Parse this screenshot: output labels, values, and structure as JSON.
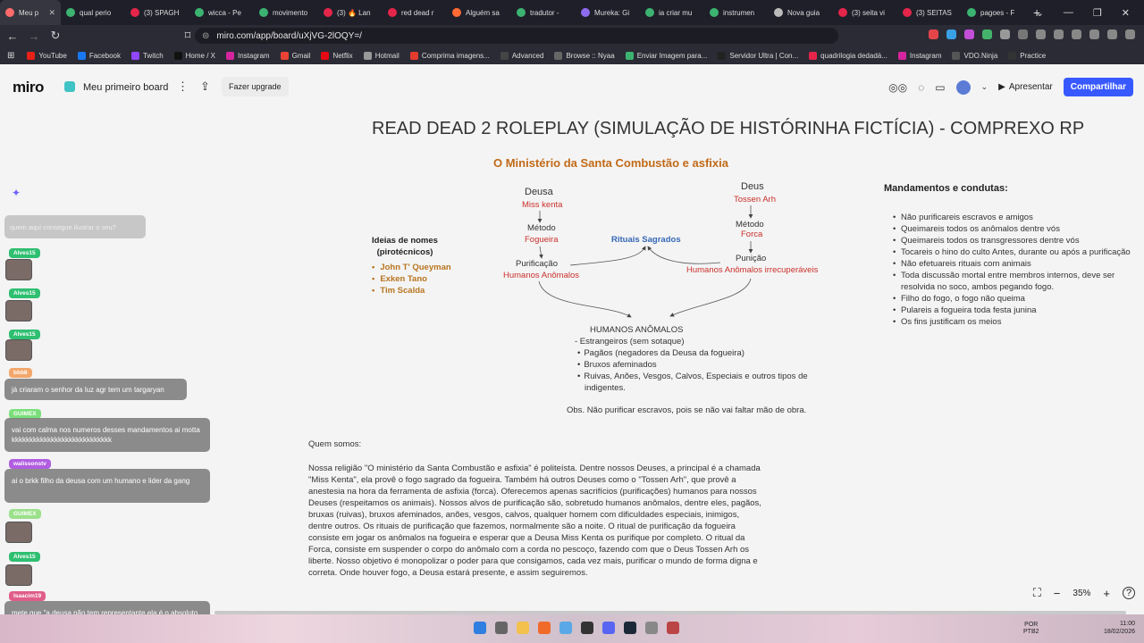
{
  "browser": {
    "tabs": [
      {
        "title": "Meu p",
        "color": "#ff6b6b",
        "active": true
      },
      {
        "title": "qual perio",
        "color": "#3cb371"
      },
      {
        "title": "(3) SPAGH",
        "color": "#e5254a"
      },
      {
        "title": "wicca - Pe",
        "color": "#3cb371"
      },
      {
        "title": "movimento",
        "color": "#3cb371"
      },
      {
        "title": "(3) 🔥 Lan",
        "color": "#e5254a"
      },
      {
        "title": "red dead r",
        "color": "#e5254a"
      },
      {
        "title": "Alguém sa",
        "color": "#ff6b35"
      },
      {
        "title": "tradutor -",
        "color": "#3cb371"
      },
      {
        "title": "Mureka: Gi",
        "color": "#8e6cf0"
      },
      {
        "title": "ia criar mu",
        "color": "#3cb371"
      },
      {
        "title": "instrumen",
        "color": "#3cb371"
      },
      {
        "title": "Nova guia",
        "color": "#bbbbbb"
      },
      {
        "title": "(3) seita vi",
        "color": "#e5254a"
      },
      {
        "title": "(3) SEITAS",
        "color": "#e5254a"
      },
      {
        "title": "pagoes - F",
        "color": "#3cb371"
      }
    ],
    "new_tab": "+",
    "window_controls": [
      "⌄",
      "—",
      "❐",
      "✕"
    ],
    "url": "miro.com/app/board/uXjVG-2lOQY=/",
    "bookmarks": [
      {
        "label": "YouTube",
        "color": "#e62117"
      },
      {
        "label": "Facebook",
        "color": "#1877f2"
      },
      {
        "label": "Twitch",
        "color": "#9146ff"
      },
      {
        "label": "Home / X",
        "color": "#111111"
      },
      {
        "label": "Instagram",
        "color": "#d6249f"
      },
      {
        "label": "Gmail",
        "color": "#ea4335"
      },
      {
        "label": "Netflix",
        "color": "#e50914"
      },
      {
        "label": "Hotmail",
        "color": "#999999"
      },
      {
        "label": "Comprima imagens...",
        "color": "#e33b2e"
      },
      {
        "label": "Advanced",
        "color": "#444444"
      },
      {
        "label": "Browse :: Nyaa",
        "color": "#666666"
      },
      {
        "label": "Enviar Imagem para...",
        "color": "#3cb371"
      },
      {
        "label": "Servidor Ultra | Con...",
        "color": "#222222"
      },
      {
        "label": "quadrilogia dedadá...",
        "color": "#e5254a"
      },
      {
        "label": "Instagram",
        "color": "#d6249f"
      },
      {
        "label": "VDO.Ninja",
        "color": "#555555"
      },
      {
        "label": "Practice",
        "color": "#333333"
      }
    ]
  },
  "miro": {
    "logo": "miro",
    "board_name": "Meu primeiro board",
    "kebab": "⋮",
    "upload_icon": "⇪",
    "upgrade_label": "Fazer upgrade",
    "present_label": "Apresentar",
    "share_label": "Compartilhar"
  },
  "board": {
    "title": "READ DEAD 2 ROLEPLAY (SIMULAÇÃO DE HISTÓRINHA FICTÍCIA) - COMPREXO RP",
    "subtitle": "O Ministério da Santa Combustão e asfixia",
    "deusa": {
      "label": "Deusa",
      "name": "Miss kenta",
      "metodo_label": "Método",
      "metodo": "Fogueira",
      "purificacao_label": "Purificação",
      "purificacao": "Humanos Anômalos"
    },
    "deus": {
      "label": "Deus",
      "name": "Tossen Arh",
      "metodo_label": "Método",
      "metodo": "Forca",
      "punicao_label": "Punição",
      "punicao": "Humanos Anômalos irrecuperáveis"
    },
    "rituais": "Rituais Sagrados",
    "names_title_1": "Ideias de nomes",
    "names_title_2": "(pirotécnicos)",
    "names": [
      "John T' Queyman",
      "Exken Tano",
      "Tim Scalda"
    ],
    "humanos": {
      "title": "HUMANOS ANÔMALOS",
      "first": "- Estrangeiros (sem sotaque)",
      "items": [
        "Pagãos (negadores da Deusa da fogueira)",
        "Bruxos afeminados",
        "Ruivas, Anões, Vesgos, Calvos, Especiais e outros tipos de",
        "indigentes."
      ]
    },
    "obs": "Obs. Não purificar escravos, pois se não vai faltar mão de obra.",
    "mandamentos_title": "Mandamentos e condutas:",
    "mandamentos": [
      "Não purificareis escravos e amigos",
      "Queimareis todos os anômalos dentre vós",
      "Queimareis todos os transgressores dentre vós",
      "Tocareis o hino do culto Antes, durante ou após a purificação",
      "Não efetuareis rituais com animais",
      "Toda discussão mortal entre membros internos, deve ser resolvida no soco, ambos pegando fogo.",
      "Filho do fogo, o fogo não queima",
      "Pulareis a fogueira toda festa junina",
      "Os fins justificam os meios"
    ],
    "quem_somos": "Quem somos:",
    "paragraph": "Nossa religião \"O ministério da Santa Combustão e asfixia\" é politeísta. Dentre nossos Deuses, a principal é a chamada \"Miss Kenta\", ela provê o fogo sagrado da fogueira. Também há outros Deuses como o \"Tossen Arh\", que provê a anestesia na hora da ferramenta de asfixia (forca). Oferecemos apenas sacrifícios (purificações) humanos para nossos Deuses (respeitamos os animais). Nossos alvos de purificação são, sobretudo humanos anômalos, dentre eles, pagãos, bruxas (ruivas), bruxos afeminados, anões, vesgos, calvos, qualquer homem com dificuldades especiais, inimigos, dentre outros. Os rituais de purificação que fazemos, normalmente são a noite. O ritual de purificação da fogueira consiste em jogar os anômalos na fogueira e esperar que a Deusa Miss Kenta os purifique por completo. O ritual da Forca, consiste em suspender o corpo do anômalo com a corda no pescoço, fazendo com que o Deus Tossen Arh os liberte. Nosso objetivo é monopolizar o poder para que consigamos, cada vez mais, purificar o mundo de forma digna e correta. Onde houver fogo, a Deusa estará presente, e assim seguiremos."
  },
  "chat": {
    "ghost": "quem aqui consegue ilustrar o seu?",
    "users": [
      {
        "name": "Alves15",
        "color": "#2fbf71"
      },
      {
        "name": "Alves15",
        "color": "#2fbf71"
      },
      {
        "name": "Alves15",
        "color": "#2fbf71"
      },
      {
        "name": "bbb8",
        "color": "#f3a76b"
      },
      {
        "name": "GUIMEX",
        "color": "#7be07b"
      },
      {
        "name": "walissonstv",
        "color": "#b05de0"
      },
      {
        "name": "GUIMEX",
        "color": "#9be08b"
      },
      {
        "name": "Alves15",
        "color": "#2fbf71"
      },
      {
        "name": "Isaacim19",
        "color": "#e05d8a"
      }
    ],
    "messages": [
      "já criaram o senhor da luz agr tem um targaryan",
      "vai com calma nos numeros desses mandamentos ai motta kkkkkkkkkkkkkkkkkkkkkkkkkkkk",
      "ai o brkk filho da deusa com um humano e lider da gang",
      "mete que \"a deusa não tem representante ela é o absoluto que irá consumir tudo que ficar a frente de seu nome tal qual o fogo\""
    ]
  },
  "zoom": {
    "level": "35%",
    "minus": "−",
    "plus": "+",
    "help": "?"
  },
  "taskbar": {
    "lang_1": "POR",
    "lang_2": "PTB2",
    "time": "11:00",
    "date": "18/02/2026"
  }
}
